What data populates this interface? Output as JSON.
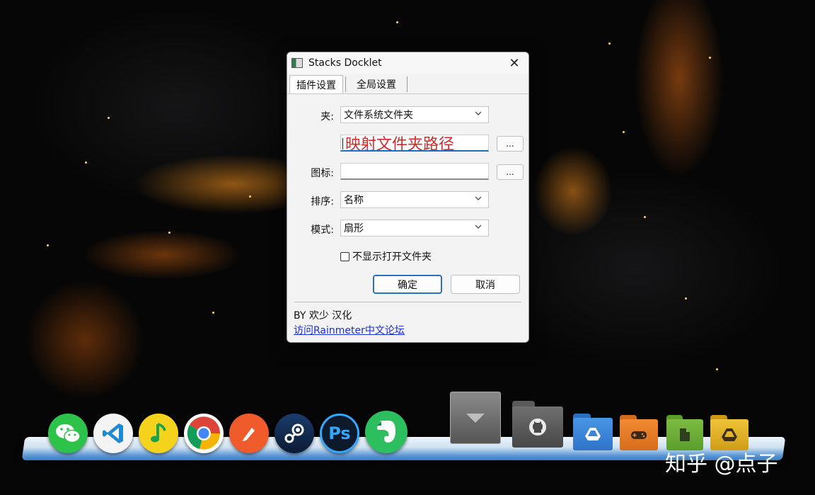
{
  "window": {
    "title": "Stacks Docklet",
    "close_glyph": "✕"
  },
  "tabs": [
    {
      "label": "插件设置",
      "active": true
    },
    {
      "label": "全局设置",
      "active": false
    }
  ],
  "form": {
    "folder_label": "夹:",
    "folder_type_value": "文件系统文件夹",
    "path_value": "映射文件夹路径",
    "icon_label": "图标:",
    "icon_value": "",
    "sort_label": "排序:",
    "sort_value": "名称",
    "mode_label": "模式:",
    "mode_value": "扇形",
    "browse_label": "...",
    "checkbox_label": "不显示打开文件夹",
    "checkbox_checked": false,
    "ok_label": "确定",
    "cancel_label": "取消"
  },
  "footer": {
    "credit": "BY 欢少 汉化",
    "link": "访问Rainmeter中文论坛"
  },
  "dock": {
    "icons": [
      "wechat-icon",
      "vscode-icon",
      "qq-music-icon",
      "chrome-icon",
      "postman-icon",
      "steam-icon",
      "photoshop-icon",
      "evernote-icon"
    ],
    "photoshop_text": "Ps",
    "folders": [
      "github-folder-icon",
      "google-drive-folder-icon",
      "games-folder-icon",
      "documents-folder-icon",
      "drive-folder-icon"
    ]
  },
  "watermark": "知乎 @点子"
}
